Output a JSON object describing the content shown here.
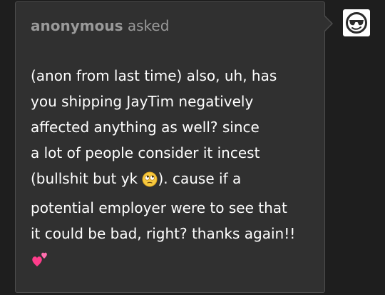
{
  "ask": {
    "asker_name": "anonymous",
    "asked_label": "asked",
    "question_lines": [
      "(anon from last time) also, uh, has",
      "you shipping JayTim negatively",
      "affected anything as well? since",
      "a lot of people consider it incest",
      "(bullshit but yk ",
      "). cause if a",
      "potential employer were to see that",
      "it could be bad, right? thanks again!!"
    ],
    "emojis": [
      "face-with-rolling-eyes",
      "two-hearts"
    ]
  },
  "avatar": {
    "icon": "sunglasses-face-avatar"
  },
  "colors": {
    "background": "#1e1e1e",
    "card": "#303030",
    "card_border": "#4d4d4d",
    "meta_text": "#9a9a9a",
    "question_text": "#ffffff"
  }
}
